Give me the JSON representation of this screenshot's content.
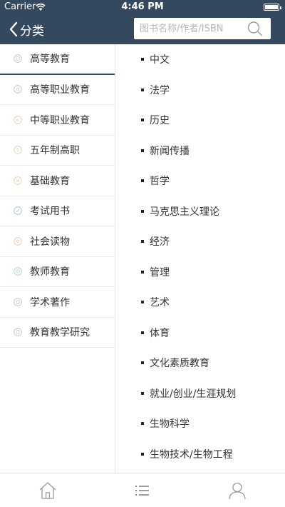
{
  "status_bar": {
    "carrier": "Carrier",
    "time": "4:46 PM"
  },
  "nav": {
    "back_label": "分类",
    "search_placeholder": "图书名称/作者/ISBN",
    "search_value": ""
  },
  "categories": [
    {
      "label": "高等教育",
      "icon": "book-icon",
      "selected": true
    },
    {
      "label": "高等职业教育",
      "icon": "circle-icon"
    },
    {
      "label": "中等职业教育",
      "icon": "chart-icon"
    },
    {
      "label": "五年制高职",
      "icon": "number-icon"
    },
    {
      "label": "基础教育",
      "icon": "star-icon"
    },
    {
      "label": "考试用书",
      "icon": "pen-icon"
    },
    {
      "label": "社会读物",
      "icon": "heart-icon"
    },
    {
      "label": "教师教育",
      "icon": "board-icon"
    },
    {
      "label": "学术著作",
      "icon": "document-icon"
    },
    {
      "label": "教育教学研究",
      "icon": "document-icon"
    }
  ],
  "subcategories": [
    "中文",
    "法学",
    "历史",
    "新闻传播",
    "哲学",
    "马克思主义理论",
    "经济",
    "管理",
    "艺术",
    "体育",
    "文化素质教育",
    "就业/创业/生涯规划",
    "生物科学",
    "生物技术/生物工程"
  ],
  "tabs": [
    {
      "name": "home",
      "icon": "home-icon"
    },
    {
      "name": "category",
      "icon": "list-icon",
      "active": true
    },
    {
      "name": "profile",
      "icon": "user-icon"
    }
  ],
  "colors": {
    "nav_bg": "#34495e",
    "text": "#333333",
    "divider": "#ececec"
  }
}
